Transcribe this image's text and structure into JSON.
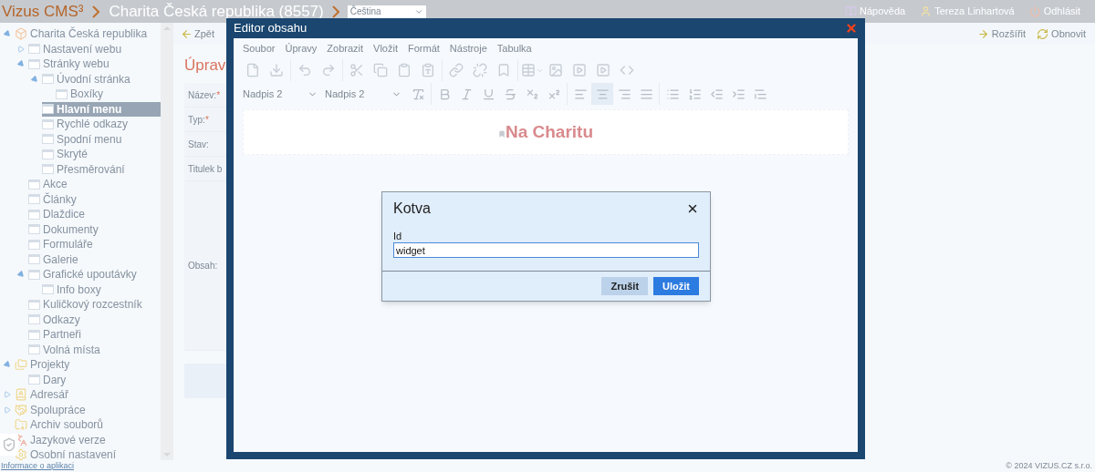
{
  "top_bar": {
    "logo": "Vizus CMS³",
    "site": "Charita Česká republika (8557)",
    "language": "Čeština",
    "links": [
      {
        "kind": "help",
        "label": "Nápověda"
      },
      {
        "kind": "user",
        "label": "Tereza Linhartová"
      },
      {
        "kind": "logout",
        "label": "Odhlásit"
      }
    ]
  },
  "sidebar": {
    "tree": [
      {
        "label": "Charita Česká republika",
        "kind": "site",
        "expanded": true,
        "selected": false,
        "children": [
          {
            "label": "Nastavení webu",
            "kind": "page",
            "expanded": false,
            "selected": false
          },
          {
            "label": "Stránky webu",
            "kind": "page",
            "expanded": true,
            "selected": false,
            "children": [
              {
                "label": "Úvodní stránka",
                "kind": "page",
                "expanded": true,
                "selected": false,
                "children": [
                  {
                    "label": "Boxíky",
                    "kind": "page",
                    "selected": false
                  }
                ]
              },
              {
                "label": "Hlavní menu",
                "kind": "page",
                "selected": true
              },
              {
                "label": "Rychlé odkazy",
                "kind": "page",
                "selected": false
              },
              {
                "label": "Spodní menu",
                "kind": "page",
                "selected": false
              },
              {
                "label": "Skryté",
                "kind": "page",
                "selected": false
              },
              {
                "label": "Přesměrování",
                "kind": "page",
                "selected": false
              }
            ]
          },
          {
            "label": "Akce",
            "kind": "page",
            "selected": false
          },
          {
            "label": "Články",
            "kind": "page",
            "selected": false
          },
          {
            "label": "Dlaždice",
            "kind": "page",
            "selected": false
          },
          {
            "label": "Dokumenty",
            "kind": "page",
            "selected": false
          },
          {
            "label": "Formuláře",
            "kind": "page",
            "selected": false
          },
          {
            "label": "Galerie",
            "kind": "page",
            "selected": false
          },
          {
            "label": "Grafické upoutávky",
            "kind": "page",
            "expanded": true,
            "selected": false,
            "children": [
              {
                "label": "Info boxy",
                "kind": "page",
                "selected": false
              }
            ]
          },
          {
            "label": "Kuličkový rozcestník",
            "kind": "page",
            "selected": false
          },
          {
            "label": "Odkazy",
            "kind": "page",
            "selected": false
          },
          {
            "label": "Partneři",
            "kind": "page",
            "selected": false
          },
          {
            "label": "Volná místa",
            "kind": "page",
            "selected": false
          }
        ]
      },
      {
        "label": "Projekty",
        "kind": "projects",
        "expanded": true,
        "selected": false,
        "children": [
          {
            "label": "Dary",
            "kind": "page",
            "selected": false
          }
        ]
      },
      {
        "label": "Adresář",
        "kind": "addressbook",
        "expanded": false,
        "selected": false
      },
      {
        "label": "Spolupráce",
        "kind": "collab",
        "expanded": false,
        "selected": false
      },
      {
        "label": "Archiv souborů",
        "kind": "archive",
        "selected": false
      },
      {
        "label": "Jazykové verze",
        "kind": "languages",
        "selected": false
      },
      {
        "label": "Osobní nastavení",
        "kind": "settings",
        "selected": false
      }
    ]
  },
  "content": {
    "toolbar": {
      "back": "Zpět",
      "right": [
        {
          "kind": "expand",
          "label": "Rozšířit"
        },
        {
          "kind": "refresh",
          "label": "Obnovit"
        }
      ]
    },
    "heading": "Úprav",
    "fields": [
      {
        "label": "Název:",
        "mark": "*"
      },
      {
        "label": "Typ:",
        "mark": "*"
      },
      {
        "label": "Stav:"
      },
      {
        "label": "Titulek b"
      },
      {
        "label": "Obsah:",
        "kind": "tall"
      }
    ]
  },
  "footer": {
    "info_link": "Informace o aplikaci",
    "copyright": "© 2024 VIZUS.CZ s.r.o."
  },
  "editor_dialog": {
    "title": "Editor obsahu",
    "menu": [
      "Soubor",
      "Úpravy",
      "Zobrazit",
      "Vložit",
      "Formát",
      "Nástroje",
      "Tabulka"
    ],
    "toolbar_row_1": [
      [
        {
          "kind": "new-document"
        },
        {
          "kind": "download"
        }
      ],
      [
        {
          "kind": "undo"
        },
        {
          "kind": "redo"
        }
      ],
      [
        {
          "kind": "cut"
        },
        {
          "kind": "copy"
        },
        {
          "kind": "paste"
        },
        {
          "kind": "paste-text"
        }
      ],
      [
        {
          "kind": "link"
        },
        {
          "kind": "unlink"
        },
        {
          "kind": "anchor"
        }
      ],
      [
        {
          "kind": "table"
        },
        {
          "kind": "image"
        },
        {
          "kind": "media"
        },
        {
          "kind": "video"
        },
        {
          "kind": "source-code"
        }
      ]
    ],
    "block_format": "Nadpis 2",
    "font_format": "Nadpis 2",
    "toolbar_row_2": [
      [
        {
          "kind": "clear-format",
          "active": false
        }
      ],
      [
        {
          "kind": "bold",
          "active": false
        },
        {
          "kind": "italic",
          "active": false
        },
        {
          "kind": "underline",
          "active": false
        },
        {
          "kind": "strikethrough",
          "active": false
        },
        {
          "kind": "subscript",
          "active": false
        },
        {
          "kind": "superscript",
          "active": false
        }
      ],
      [
        {
          "kind": "align-left",
          "active": false
        },
        {
          "kind": "align-center",
          "active": true
        },
        {
          "kind": "align-right",
          "active": false
        },
        {
          "kind": "justify",
          "active": false
        }
      ],
      [
        {
          "kind": "bullet-list",
          "active": false
        },
        {
          "kind": "numbered-list",
          "active": false
        },
        {
          "kind": "outdent",
          "active": false
        },
        {
          "kind": "indent",
          "active": false
        },
        {
          "kind": "blockquote",
          "active": false
        }
      ]
    ],
    "document_heading": "Na Charitu"
  },
  "anchor_dialog": {
    "title": "Kotva",
    "field_label": "Id",
    "value": "widget",
    "buttons": [
      {
        "kind": "secondary",
        "label": "Zrušit"
      },
      {
        "kind": "primary",
        "label": "Uložit"
      }
    ]
  }
}
